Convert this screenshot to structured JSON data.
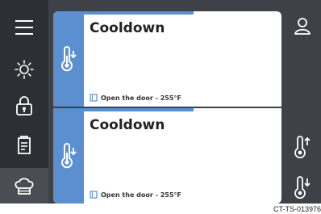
{
  "nav": {
    "items": [
      {
        "icon": "menu-icon",
        "active": false
      },
      {
        "icon": "sun-icon",
        "active": false
      },
      {
        "icon": "lock-icon",
        "active": false
      },
      {
        "icon": "recipe-book-icon",
        "active": false
      },
      {
        "icon": "chef-hat-icon",
        "active": true
      }
    ]
  },
  "right_bar": {
    "icons": [
      "user-icon",
      "temperature-up-icon",
      "temperature-down-icon"
    ]
  },
  "cards": [
    {
      "title": "Cooldown",
      "status": "Open the door - 255°F",
      "progress": 0.48,
      "icon": "temperature-down-icon"
    },
    {
      "title": "Cooldown",
      "status": "Open the door - 255°F",
      "progress": 0.48,
      "icon": "temperature-down-icon"
    }
  ],
  "footer": {
    "code": "CT-TS-013976"
  },
  "colors": {
    "accent": "#5b8fd0",
    "sidebar": "#2c2f33",
    "panel": "#3e4147",
    "active": "#4a4d53"
  }
}
